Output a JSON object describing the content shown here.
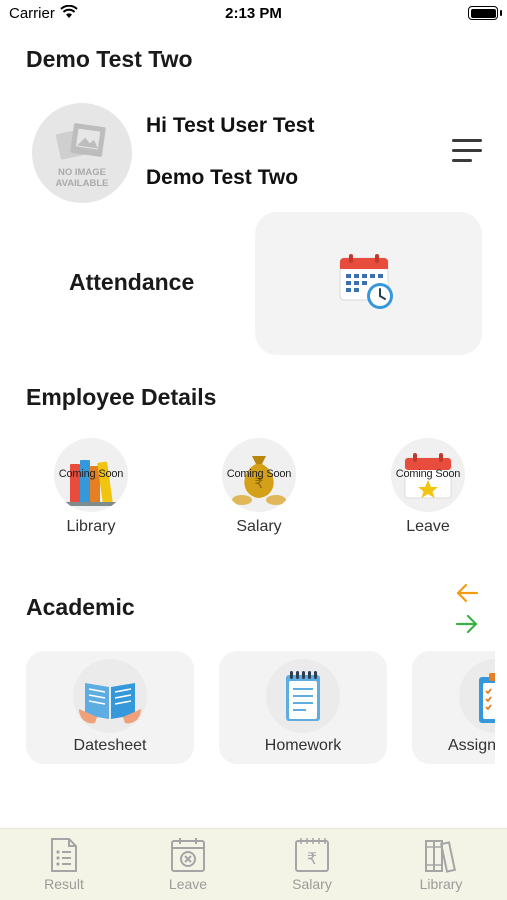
{
  "status_bar": {
    "carrier": "Carrier",
    "time": "2:13 PM"
  },
  "header": {
    "title": "Demo Test Two"
  },
  "profile": {
    "avatar_placeholder_line1": "NO IMAGE",
    "avatar_placeholder_line2": "AVAILABLE",
    "greeting": "Hi Test User Test",
    "school": "Demo Test Two"
  },
  "attendance": {
    "label": "Attendance",
    "icon": "calendar-clock-icon"
  },
  "employee_details": {
    "title": "Employee Details",
    "items": [
      {
        "label": "Library",
        "badge": "Coming Soon",
        "icon": "books-icon"
      },
      {
        "label": "Salary",
        "badge": "Coming Soon",
        "icon": "money-bag-icon"
      },
      {
        "label": "Leave",
        "badge": "Coming Soon",
        "icon": "calendar-star-icon"
      }
    ]
  },
  "academic": {
    "title": "Academic",
    "items": [
      {
        "label": "Datesheet",
        "icon": "open-book-icon"
      },
      {
        "label": "Homework",
        "icon": "notepad-icon"
      },
      {
        "label": "Assignment",
        "icon": "clipboard-icon"
      }
    ]
  },
  "tab_bar": {
    "items": [
      {
        "label": "Result",
        "icon": "result-sheet-icon"
      },
      {
        "label": "Leave",
        "icon": "calendar-x-icon"
      },
      {
        "label": "Salary",
        "icon": "rupee-note-icon"
      },
      {
        "label": "Library",
        "icon": "books-icon"
      }
    ]
  },
  "colors": {
    "card_bg": "#f3f3f3",
    "tab_bar_bg": "#f4f4e6",
    "arrow_left": "#f39c12",
    "arrow_right": "#3cb043",
    "calendar_red": "#e74c3c",
    "clock_blue": "#3498db"
  }
}
